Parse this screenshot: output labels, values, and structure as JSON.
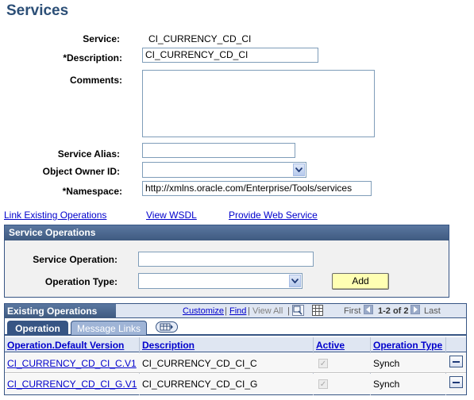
{
  "page": {
    "title": "Services"
  },
  "form": {
    "service_label": "Service:",
    "service_value": "CI_CURRENCY_CD_CI",
    "description_label": "*Description:",
    "description_value": "CI_CURRENCY_CD_CI",
    "comments_label": "Comments:",
    "comments_value": "",
    "alias_label": "Service Alias:",
    "alias_value": "",
    "owner_label": "Object Owner ID:",
    "owner_value": "",
    "namespace_label": "*Namespace:",
    "namespace_value": "http://xmlns.oracle.com/Enterprise/Tools/services"
  },
  "links": {
    "link_existing": "Link Existing Operations",
    "view_wsdl": "View WSDL",
    "provide_ws": "Provide Web Service"
  },
  "service_ops": {
    "header": "Service Operations",
    "op_label": "Service Operation:",
    "op_value": "",
    "type_label": "Operation Type:",
    "type_value": "",
    "add_label": "Add"
  },
  "existing": {
    "header": "Existing Operations",
    "customize": "Customize",
    "sep1": "|",
    "find": "Find",
    "sep2": "|",
    "view_all": "View All",
    "sep3": "|",
    "first": "First",
    "range": "1-2 of 2",
    "last": "Last",
    "tabs": [
      "Operation",
      "Message Links"
    ],
    "columns": [
      "Operation.Default Version",
      "Description",
      "Active",
      "Operation Type"
    ],
    "rows": [
      {
        "operation": "CI_CURRENCY_CD_CI_C.V1",
        "description": "CI_CURRENCY_CD_CI_C",
        "active": true,
        "type": "Synch"
      },
      {
        "operation": "CI_CURRENCY_CD_CI_G.V1",
        "description": "CI_CURRENCY_CD_CI_G",
        "active": true,
        "type": "Synch"
      }
    ]
  },
  "colors": {
    "title": "#2c4f77",
    "header_bg": "#4a6384",
    "link": "#0000cc",
    "button_bg": "#ffffb3",
    "tab_active": "#375584",
    "tab_inactive": "#9fb4d6"
  },
  "icons": [
    "dropdown-arrow-icon",
    "zoom-icon",
    "grid-icon",
    "show-all-columns-icon",
    "prev-arrow-icon",
    "next-arrow-icon",
    "delete-row-icon",
    "checkmark-icon"
  ]
}
